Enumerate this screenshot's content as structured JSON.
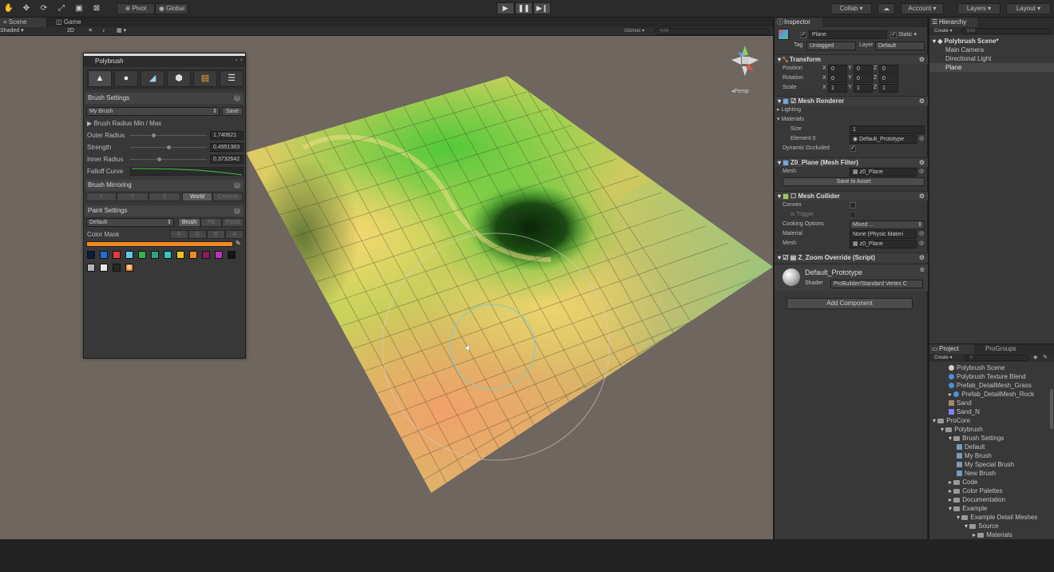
{
  "toolbar": {
    "pivot_label": "Pivot",
    "global_label": "Global",
    "collab_label": "Collab",
    "account_label": "Account",
    "layers_label": "Layers",
    "layout_label": "Layout"
  },
  "scene": {
    "tabs": [
      "Scene",
      "Game"
    ],
    "shading_mode": "Shaded",
    "mode_2d": "2D",
    "gizmos_label": "Gizmos",
    "search_placeholder": "All",
    "gizmo_persp_label": "Persp",
    "cursor_x": 0.6,
    "cursor_y": 0.61
  },
  "polybrush": {
    "title": "Polybrush",
    "brush_settings_header": "Brush Settings",
    "brush_name": "My Brush",
    "save_label": "Save",
    "radius_minmax_label": "Brush Radius Min / Max",
    "outer_radius_label": "Outer Radius",
    "outer_radius_value": "1.740621",
    "outer_radius_fraction": 0.3,
    "strength_label": "Strength",
    "strength_value": "0.4951383",
    "strength_fraction": 0.5,
    "inner_radius_label": "Inner Radius",
    "inner_radius_value": "0.3732642",
    "inner_radius_fraction": 0.37,
    "falloff_label": "Falloff Curve",
    "mirroring_header": "Brush Mirroring",
    "mirror_axes": [
      "X",
      "Y",
      "Z"
    ],
    "mirror_world": "World",
    "mirror_camera": "Camera",
    "paint_header": "Paint Settings",
    "paint_preset": "Default",
    "paint_modes": [
      "Brush",
      "Fill",
      "Flood"
    ],
    "color_mask_label": "Color Mask",
    "color_mask_channels": [
      "R",
      "G",
      "B",
      "A"
    ],
    "selected_color": "#f08a22",
    "palette": [
      "#0d1b3d",
      "#1f6fd6",
      "#e83c36",
      "#5fc8f0",
      "#36b24a",
      "#2ea680",
      "#36c4c4",
      "#ecc21e",
      "#f08a22",
      "#8a1f56",
      "#b832b8",
      "#151515",
      "#b4b4b4",
      "#e6e6e6",
      "#262626"
    ]
  },
  "inspector": {
    "tab": "Inspector",
    "object_name": "Plane",
    "static_label": "Static",
    "tag_label": "Tag",
    "tag_value": "Untagged",
    "layer_label": "Layer",
    "layer_value": "Default",
    "transform": {
      "header": "Transform",
      "position_label": "Position",
      "rotation_label": "Rotation",
      "scale_label": "Scale",
      "position": [
        "0",
        "0",
        "0"
      ],
      "rotation": [
        "0",
        "0",
        "0"
      ],
      "scale": [
        "1",
        "1",
        "1"
      ],
      "axes": [
        "X",
        "Y",
        "Z"
      ]
    },
    "mesh_renderer": {
      "header": "Mesh Renderer",
      "lighting_label": "Lighting",
      "materials_label": "Materials",
      "size_label": "Size",
      "size_value": "1",
      "element_label": "Element 0",
      "element_value": "Default_Prototype",
      "dynamic_occluded_label": "Dynamic Occluded"
    },
    "mesh_filter": {
      "header": "Z0_Plane (Mesh Filter)",
      "mesh_label": "Mesh",
      "mesh_value": "z0_Plane",
      "save_asset_label": "Save to Asset"
    },
    "mesh_collider": {
      "header": "Mesh Collider",
      "convex_label": "Convex",
      "trigger_label": "Is Trigger",
      "cooking_label": "Cooking Options",
      "cooking_value": "Mixed ...",
      "material_label": "Material",
      "material_value": "None (Physic Materi",
      "mesh_label": "Mesh",
      "mesh_value": "z0_Plane"
    },
    "zoom_override": {
      "header": "Z_Zoom Override (Script)"
    },
    "material": {
      "name": "Default_Prototype",
      "shader_label": "Shader",
      "shader_value": "ProBuilder/Standard Vertex C"
    },
    "add_component_label": "Add Component"
  },
  "hierarchy": {
    "tab": "Hierarchy",
    "create_label": "Create",
    "search_placeholder": "All",
    "scene_name": "Polybrush Scene*",
    "items": [
      "Main Camera",
      "Directional Light",
      "Plane"
    ]
  },
  "project": {
    "tabs": [
      "Project",
      "ProGroups"
    ],
    "create_label": "Create",
    "items": [
      {
        "label": "Polybrush Scene",
        "indent": 2,
        "kind": "scene"
      },
      {
        "label": "Polybrush Texture Blend",
        "indent": 2,
        "kind": "sphere"
      },
      {
        "label": "Prefab_DetailMesh_Grass",
        "indent": 2,
        "kind": "sphere"
      },
      {
        "label": "Prefab_DetailMesh_Rock",
        "indent": 2,
        "kind": "sphere"
      },
      {
        "label": "Sand",
        "indent": 2,
        "kind": "tex-sand"
      },
      {
        "label": "Sand_N",
        "indent": 2,
        "kind": "tex-normal"
      },
      {
        "label": "ProCore",
        "indent": 0,
        "kind": "folder"
      },
      {
        "label": "Polybrush",
        "indent": 1,
        "kind": "folder"
      },
      {
        "label": "Brush Settings",
        "indent": 2,
        "kind": "folder"
      },
      {
        "label": "Default",
        "indent": 3,
        "kind": "asset"
      },
      {
        "label": "My Brush",
        "indent": 3,
        "kind": "asset"
      },
      {
        "label": "My Special Brush",
        "indent": 3,
        "kind": "asset"
      },
      {
        "label": "New Brush",
        "indent": 3,
        "kind": "asset"
      },
      {
        "label": "Code",
        "indent": 2,
        "kind": "folder"
      },
      {
        "label": "Color Palettes",
        "indent": 2,
        "kind": "folder"
      },
      {
        "label": "Documentation",
        "indent": 2,
        "kind": "folder"
      },
      {
        "label": "Example",
        "indent": 2,
        "kind": "folder"
      },
      {
        "label": "Example Detail Meshes",
        "indent": 3,
        "kind": "folder"
      },
      {
        "label": "Source",
        "indent": 4,
        "kind": "folder"
      },
      {
        "label": "Materials",
        "indent": 5,
        "kind": "folder"
      }
    ]
  }
}
